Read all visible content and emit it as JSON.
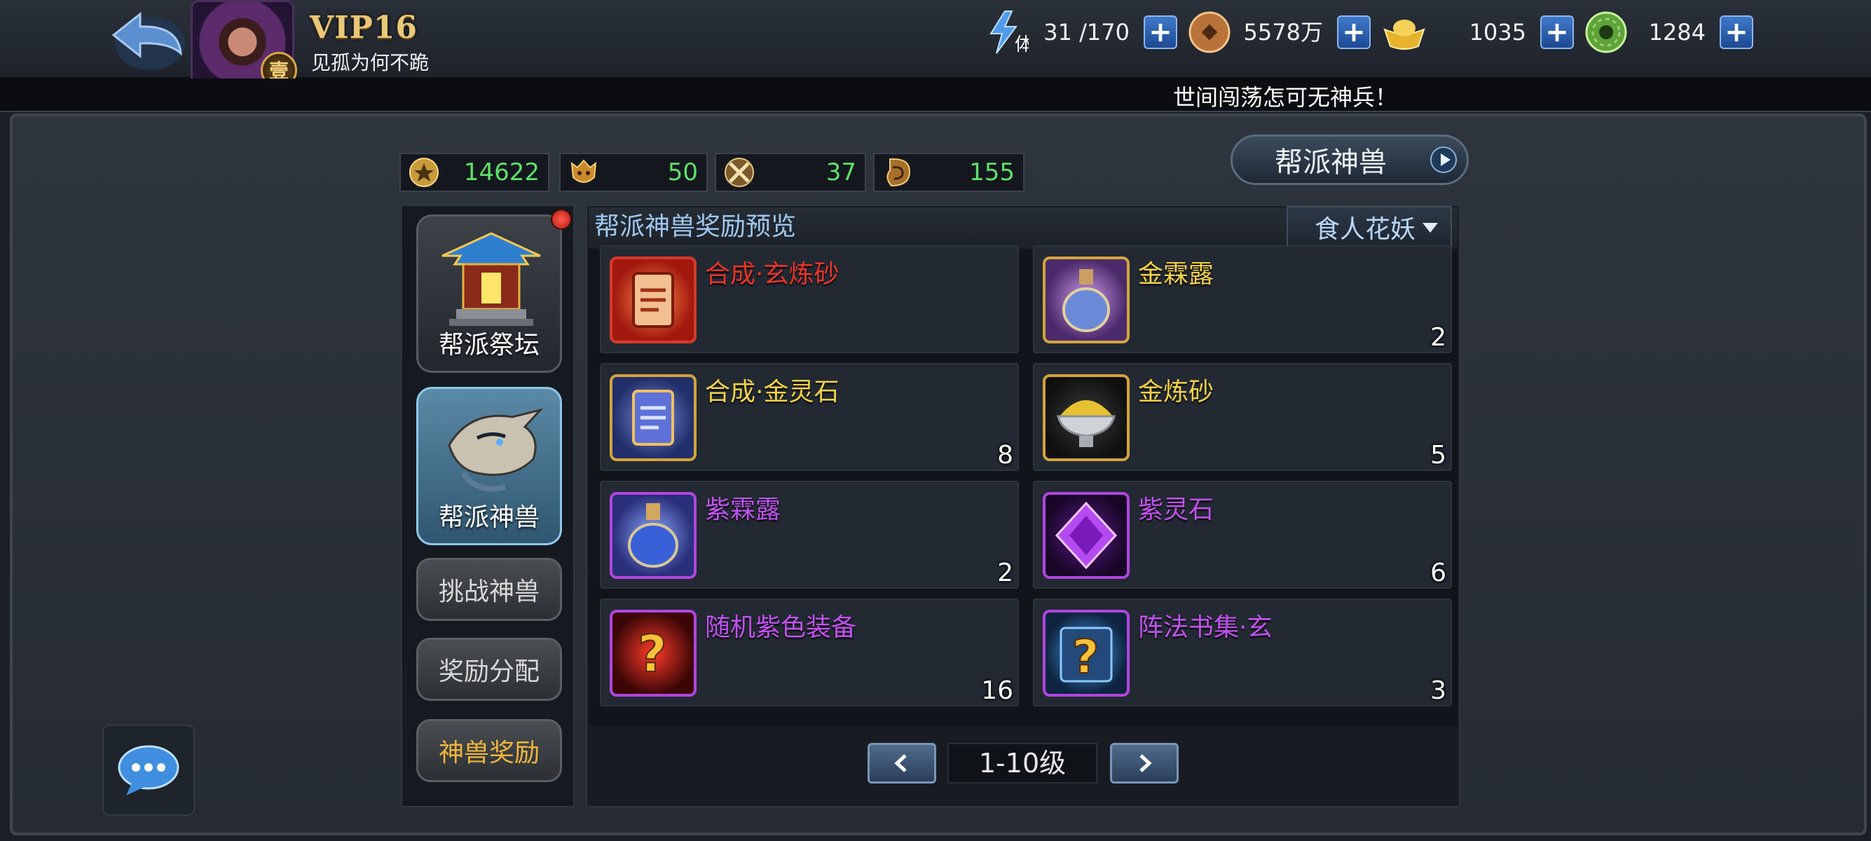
{
  "player": {
    "vip": "VIP16",
    "name": "见孤为何不跪",
    "badge": "壹"
  },
  "resources": [
    {
      "icon": "stamina-lightning-icon",
      "icon_text": "体",
      "value": "31 /170"
    },
    {
      "icon": "copper-coin-icon",
      "value": "5578万"
    },
    {
      "icon": "gold-ingot-icon",
      "value": "1035"
    },
    {
      "icon": "jade-coin-icon",
      "value": "1284"
    }
  ],
  "marquee": "世间闯荡怎可无神兵！",
  "stats": [
    {
      "icon": "guild-contribution-icon",
      "value": "14622"
    },
    {
      "icon": "beast-head-icon",
      "value": "50"
    },
    {
      "icon": "crossed-swords-icon",
      "value": "37"
    },
    {
      "icon": "scroll-token-icon",
      "value": "155"
    }
  ],
  "title_button": "帮派神兽",
  "menu": {
    "altar": "帮派祭坛",
    "beast": "帮派神兽",
    "challenge": "挑战神兽",
    "distribution": "奖励分配",
    "reward": "神兽奖励"
  },
  "panel": {
    "title": "帮派神兽奖励预览",
    "dropdown": "食人花妖"
  },
  "rewards": [
    {
      "name": "合成·玄炼砂",
      "count": "",
      "color": "#e8352b",
      "frame": "red",
      "icon": "red-scroll-icon"
    },
    {
      "name": "金霖露",
      "count": "2",
      "color": "#f2d24a",
      "frame": "gold",
      "icon": "gold-potion-icon"
    },
    {
      "name": "合成·金灵石",
      "count": "8",
      "color": "#f2d24a",
      "frame": "gold",
      "icon": "blue-scroll-icon"
    },
    {
      "name": "金炼砂",
      "count": "5",
      "color": "#f2d24a",
      "frame": "gold",
      "icon": "gold-sand-bowl-icon"
    },
    {
      "name": "紫霖露",
      "count": "2",
      "color": "#c052ef",
      "frame": "purple",
      "icon": "purple-potion-icon"
    },
    {
      "name": "紫灵石",
      "count": "6",
      "color": "#c052ef",
      "frame": "purple",
      "icon": "purple-gem-icon"
    },
    {
      "name": "随机紫色装备",
      "count": "16",
      "color": "#c052ef",
      "frame": "purple",
      "icon": "random-equipment-icon"
    },
    {
      "name": "阵法书集·玄",
      "count": "3",
      "color": "#c052ef",
      "frame": "purple",
      "icon": "random-book-icon"
    }
  ],
  "pager": {
    "label": "1-10级"
  }
}
